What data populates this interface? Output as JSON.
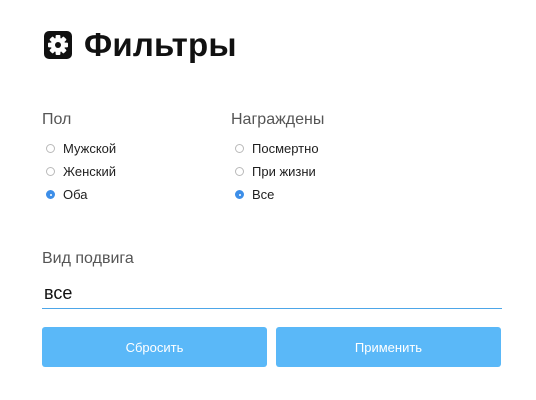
{
  "header": {
    "title": "Фильтры",
    "icon": "gear-icon"
  },
  "gender": {
    "label": "Пол",
    "options": [
      {
        "label": "Мужской",
        "checked": false
      },
      {
        "label": "Женский",
        "checked": false
      },
      {
        "label": "Оба",
        "checked": true
      }
    ]
  },
  "awarded": {
    "label": "Награждены",
    "options": [
      {
        "label": "Посмертно",
        "checked": false
      },
      {
        "label": "При жизни",
        "checked": false
      },
      {
        "label": "Все",
        "checked": true
      }
    ]
  },
  "feat": {
    "label": "Вид подвига",
    "value": "все"
  },
  "buttons": {
    "reset": "Сбросить",
    "apply": "Применить"
  },
  "colors": {
    "accent": "#3d8ee8",
    "button": "#5ab8f8",
    "underline": "#4da6e8"
  }
}
